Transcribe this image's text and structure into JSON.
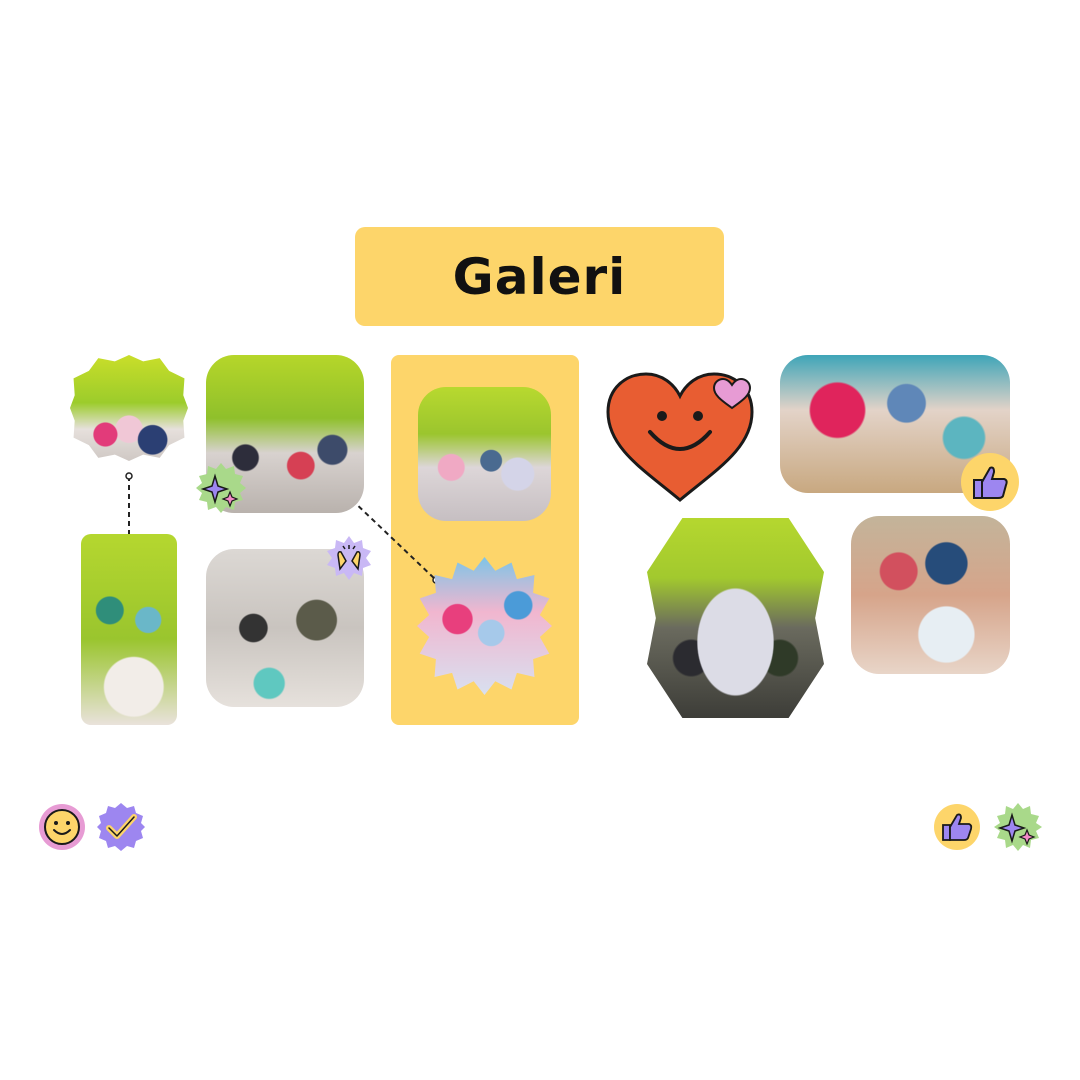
{
  "title": "Galeri",
  "icons": {
    "smiley": "smiley-face-icon",
    "check": "check-badge-icon",
    "thumbs_up": "thumbs-up-icon",
    "sparkle": "sparkle-icon",
    "clap": "clapping-hands-icon",
    "heart": "smiling-heart-icon"
  },
  "colors": {
    "accent_yellow": "#FDD56A",
    "heart_orange": "#E85D32",
    "purple": "#9D86F0",
    "green": "#A9D98A",
    "pink": "#F28BC6"
  }
}
